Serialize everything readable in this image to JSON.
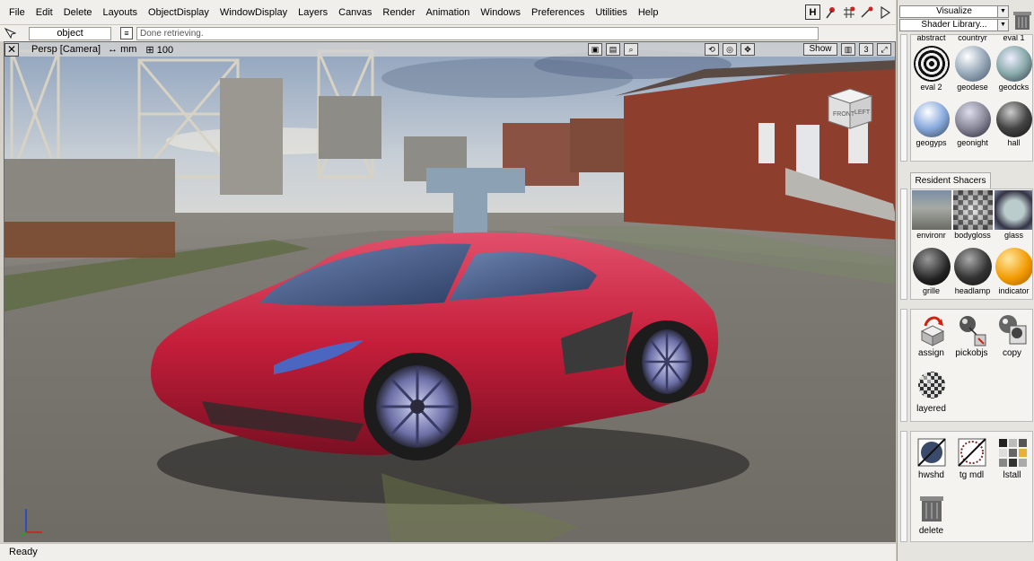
{
  "menubar": {
    "items": [
      "File",
      "Edit",
      "Delete",
      "Layouts",
      "ObjectDisplay",
      "WindowDisplay",
      "Layers",
      "Canvas",
      "Render",
      "Animation",
      "Windows",
      "Preferences",
      "Utilities",
      "Help"
    ],
    "tools": [
      "H"
    ]
  },
  "status": {
    "object_field": "object",
    "message": "Done retrieving."
  },
  "viewport": {
    "camera": "Persp [Camera]",
    "units": "mm",
    "grid": "100",
    "show_button": "Show",
    "count": "3",
    "cube_front": "FRONT",
    "cube_left": "LEFT"
  },
  "statusbar": {
    "text": "Ready"
  },
  "panel": {
    "visualize": "Visualize",
    "library": "Shader Library...",
    "top_labels": [
      "abstract",
      "countryr",
      "eval 1"
    ],
    "library_shaders": [
      {
        "label": "eval 2",
        "style": "stripe"
      },
      {
        "label": "geodese",
        "style": "sky"
      },
      {
        "label": "geodcks",
        "style": "sky2"
      },
      {
        "label": "geogyps",
        "style": "sky3"
      },
      {
        "label": "geonight",
        "style": "sky4"
      },
      {
        "label": "hall",
        "style": "dark"
      }
    ],
    "resident_tab": "Resident Shacers",
    "resident_shaders": [
      {
        "label": "environr",
        "style": "env"
      },
      {
        "label": "bodygloss",
        "style": "checker"
      },
      {
        "label": "glass",
        "style": "glass"
      },
      {
        "label": "grille",
        "style": "grille"
      },
      {
        "label": "headlamp",
        "style": "head"
      },
      {
        "label": "indicator",
        "style": "orange"
      }
    ],
    "tools_a": [
      "assign",
      "pickobjs",
      "copy",
      "layered"
    ],
    "tools_b": [
      "hwshd",
      "tg mdl",
      "lstall",
      "delete"
    ]
  },
  "colors": {
    "car_body": "#c41e3a",
    "indicator": "#f29a00",
    "panel_bg": "#e6e4de"
  }
}
